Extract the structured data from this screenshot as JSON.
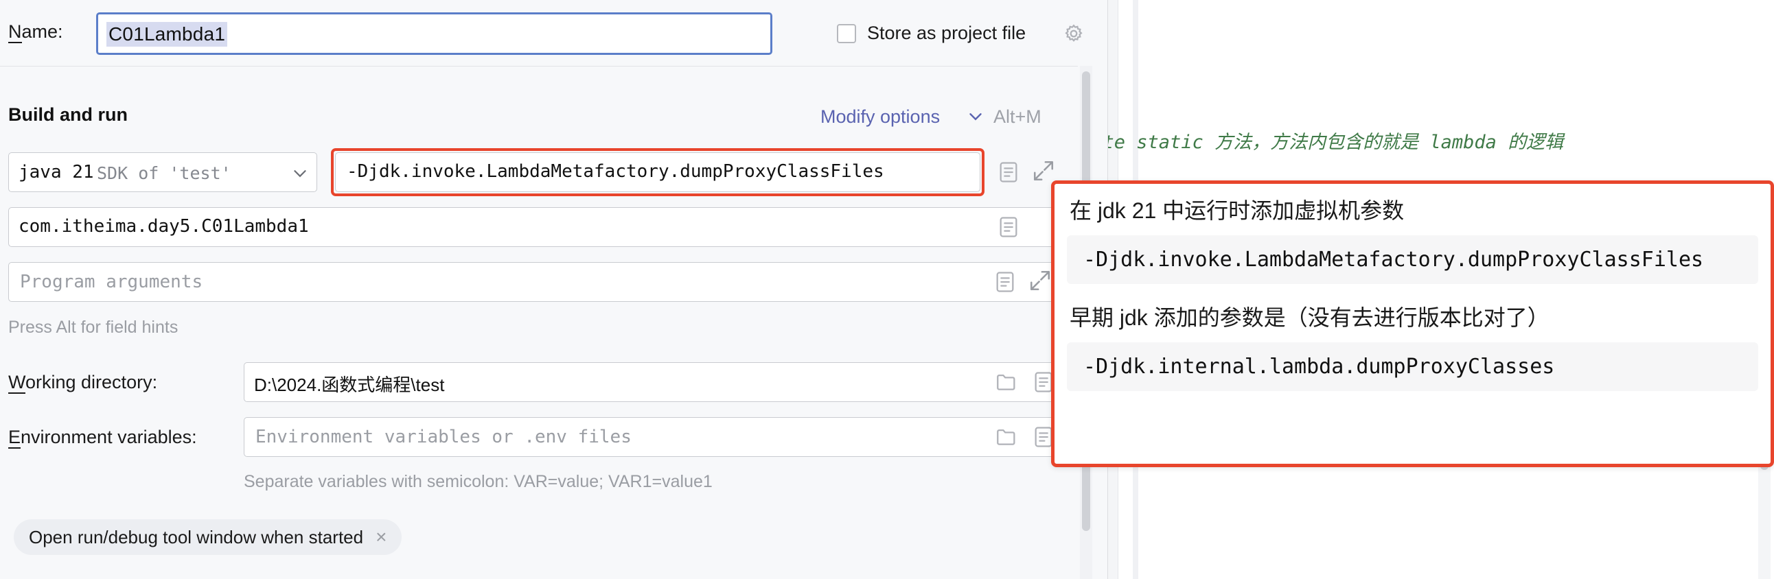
{
  "dialog": {
    "name_label": "Name:",
    "name_value": "C01Lambda1",
    "store_as_project_file_label": "Store as project file",
    "store_gear_icon": "gear-icon",
    "section_title": "Build and run",
    "modify_options_label": "Modify options",
    "modify_options_shortcut": "Alt+M",
    "jdk_primary": "java 21",
    "jdk_secondary": "SDK of 'test'",
    "vm_options_value": "-Djdk.invoke.LambdaMetafactory.dumpProxyClassFiles",
    "main_class_value": "com.itheima.day5.C01Lambda1",
    "program_arguments_placeholder": "Program arguments",
    "field_hint": "Press Alt for field hints",
    "working_directory_label": "Working directory:",
    "working_directory_value": "D:\\2024.函数式编程\\test",
    "environment_variables_label": "Environment variables:",
    "environment_variables_placeholder": "Environment variables or .env files",
    "environment_variables_hint": "Separate variables with semicolon: VAR=value; VAR1=value1",
    "tag_label": "Open run/debug tool window when started",
    "tag_close_glyph": "×",
    "icons": {
      "macro": "document-lines-icon",
      "expand": "expand-arrows-icon",
      "folder": "folder-icon",
      "chevron": "chevron-down-icon"
    }
  },
  "editor": {
    "comment_line": "vate static 方法，方法内包含的就是 lambda 的逻辑"
  },
  "annotation": {
    "heading_1": "在 jdk 21 中运行时添加虚拟机参数",
    "code_1": "-Djdk.invoke.LambdaMetafactory.dumpProxyClassFiles",
    "heading_2": "早期 jdk 添加的参数是（没有去进行版本比对了）",
    "code_2": "-Djdk.internal.lambda.dumpProxyClasses"
  },
  "colors": {
    "accent_red": "#e8452c",
    "focus_blue": "#5b7ec9",
    "link_purple": "#5a63b0",
    "comment_green": "#3f7a47"
  }
}
